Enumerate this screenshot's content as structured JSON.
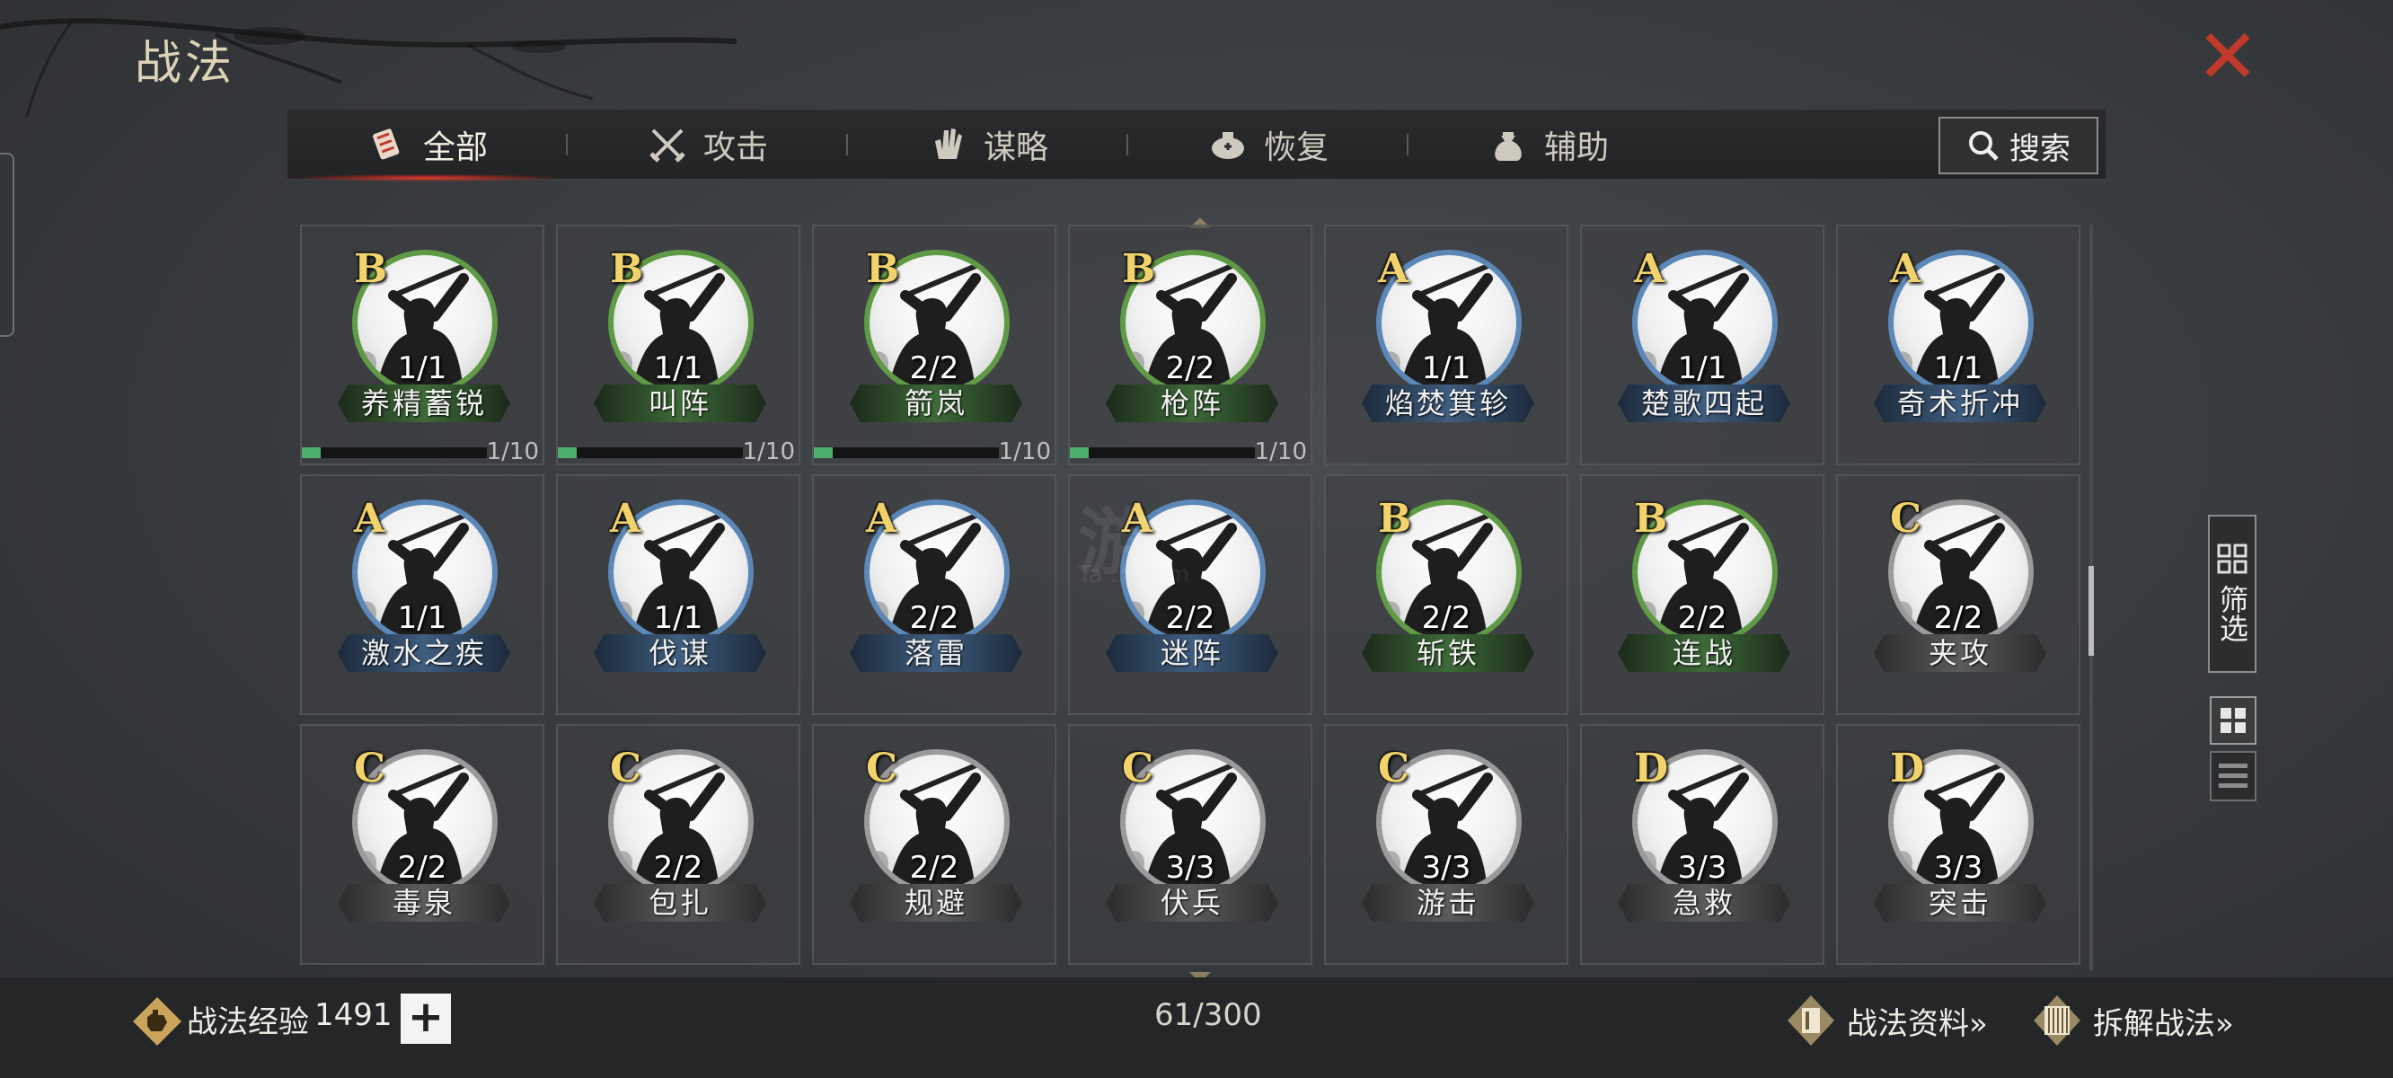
{
  "header": {
    "title": "战法"
  },
  "tabs": [
    {
      "label": "全部",
      "icon": "all-skills-icon",
      "active": true
    },
    {
      "label": "攻击",
      "icon": "crossed-swords-icon",
      "active": false
    },
    {
      "label": "谋略",
      "icon": "strategy-hand-icon",
      "active": false
    },
    {
      "label": "恢复",
      "icon": "recovery-icon",
      "active": false
    },
    {
      "label": "辅助",
      "icon": "support-bag-icon",
      "active": false
    }
  ],
  "search": {
    "label": "搜索",
    "icon": "search-icon"
  },
  "watermark": {
    "main": "游",
    "sub": "Ta ... com"
  },
  "skills": [
    {
      "grade": "B",
      "level": "1/1",
      "name": "养精蓄锐",
      "exp": "1/10",
      "exp_fraction": 0.1
    },
    {
      "grade": "B",
      "level": "1/1",
      "name": "叫阵",
      "exp": "1/10",
      "exp_fraction": 0.1
    },
    {
      "grade": "B",
      "level": "2/2",
      "name": "箭岚",
      "exp": "1/10",
      "exp_fraction": 0.1
    },
    {
      "grade": "B",
      "level": "2/2",
      "name": "枪阵",
      "exp": "1/10",
      "exp_fraction": 0.1
    },
    {
      "grade": "A",
      "level": "1/1",
      "name": "焰焚箕轸"
    },
    {
      "grade": "A",
      "level": "1/1",
      "name": "楚歌四起"
    },
    {
      "grade": "A",
      "level": "1/1",
      "name": "奇术折冲"
    },
    {
      "grade": "A",
      "level": "1/1",
      "name": "激水之疾"
    },
    {
      "grade": "A",
      "level": "1/1",
      "name": "伐谋"
    },
    {
      "grade": "A",
      "level": "2/2",
      "name": "落雷"
    },
    {
      "grade": "A",
      "level": "2/2",
      "name": "迷阵"
    },
    {
      "grade": "B",
      "level": "2/2",
      "name": "斩铁"
    },
    {
      "grade": "B",
      "level": "2/2",
      "name": "连战"
    },
    {
      "grade": "C",
      "level": "2/2",
      "name": "夹攻"
    },
    {
      "grade": "C",
      "level": "2/2",
      "name": "毒泉"
    },
    {
      "grade": "C",
      "level": "2/2",
      "name": "包扎"
    },
    {
      "grade": "C",
      "level": "2/2",
      "name": "规避"
    },
    {
      "grade": "C",
      "level": "3/3",
      "name": "伏兵"
    },
    {
      "grade": "C",
      "level": "3/3",
      "name": "游击"
    },
    {
      "grade": "D",
      "level": "3/3",
      "name": "急救"
    },
    {
      "grade": "D",
      "level": "3/3",
      "name": "突击"
    }
  ],
  "side": {
    "filter_label": "筛选"
  },
  "footer": {
    "exp_label": "战法经验",
    "exp_value": "1491",
    "plus": "+",
    "count": "61/300",
    "link1": "战法资料»",
    "link2": "拆解战法»"
  },
  "colors": {
    "accent_red": "#c0392b",
    "grade_gold": "#f2d36b",
    "exp_green": "#4caf6a"
  }
}
